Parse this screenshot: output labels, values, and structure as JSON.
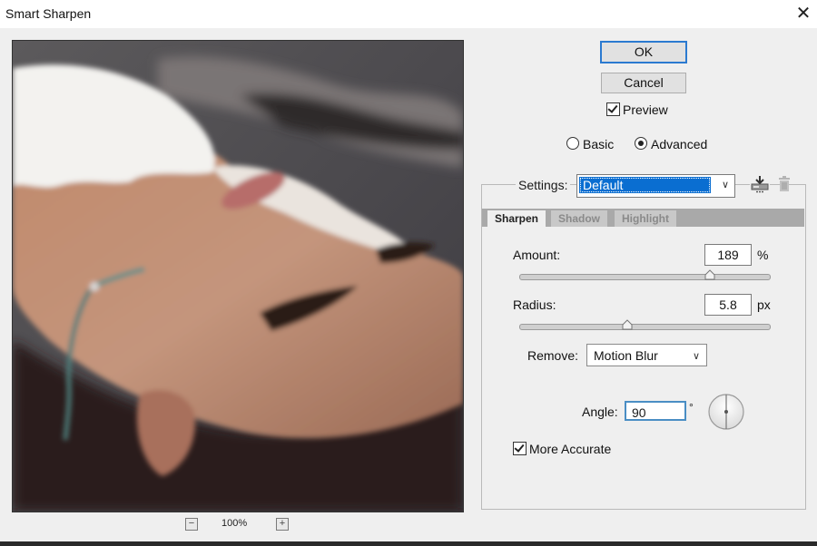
{
  "window": {
    "title": "Smart Sharpen",
    "close_icon": "close-icon"
  },
  "preview": {
    "zoom_out_label": "−",
    "zoom_level": "100%",
    "zoom_in_label": "+"
  },
  "buttons": {
    "ok": "OK",
    "cancel": "Cancel"
  },
  "preview_toggle": {
    "label": "Preview",
    "checked": true
  },
  "mode": {
    "options": [
      "Basic",
      "Advanced"
    ],
    "selected": "Advanced"
  },
  "settings": {
    "label": "Settings:",
    "value": "Default",
    "save_icon": "save-preset-icon",
    "delete_icon": "trash-icon"
  },
  "tabs": [
    {
      "label": "Sharpen",
      "active": true
    },
    {
      "label": "Shadow",
      "active": false
    },
    {
      "label": "Highlight",
      "active": false
    }
  ],
  "amount": {
    "label": "Amount:",
    "value": "189",
    "unit": "%",
    "slider_fraction": 0.76
  },
  "radius": {
    "label": "Radius:",
    "value": "5.8",
    "unit": "px",
    "slider_fraction": 0.43
  },
  "remove": {
    "label": "Remove:",
    "value": "Motion Blur"
  },
  "angle": {
    "label": "Angle:",
    "value": "90",
    "unit": "°"
  },
  "more_accurate": {
    "label": "More Accurate",
    "checked": true
  },
  "colors": {
    "accent": "#0a6ed1",
    "focus_border": "#2b7ad0",
    "dialog_bg": "#efefef"
  }
}
